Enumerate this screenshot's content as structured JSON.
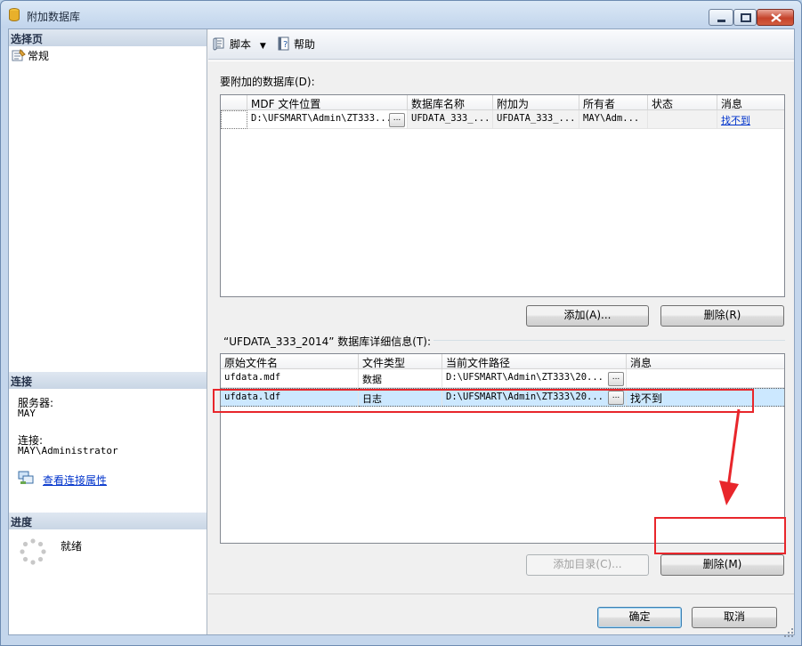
{
  "window": {
    "title": "附加数据库"
  },
  "left": {
    "select_page_header": "选择页",
    "pages": [
      {
        "label": "常规"
      }
    ],
    "connection_header": "连接",
    "server_label": "服务器:",
    "server_value": "MAY",
    "connection_label": "连接:",
    "connection_value": "MAY\\Administrator",
    "view_props_link": "查看连接属性",
    "progress_header": "进度",
    "progress_status": "就绪"
  },
  "toolbar": {
    "script_label": "脚本",
    "help_label": "帮助"
  },
  "attach": {
    "label": "要附加的数据库(D):",
    "columns": [
      "MDF 文件位置",
      "数据库名称",
      "附加为",
      "所有者",
      "状态",
      "消息"
    ],
    "rows": [
      {
        "mdf": "D:\\UFSMART\\Admin\\ZT333...",
        "db_name": "UFDATA_333_...",
        "attach_as": "UFDATA_333_...",
        "owner": "MAY\\Adm...",
        "status": "",
        "message": "找不到"
      }
    ],
    "add_button": "添加(A)...",
    "remove_button": "删除(R)"
  },
  "details": {
    "label": "“UFDATA_333_2014” 数据库详细信息(T):",
    "columns": [
      "原始文件名",
      "文件类型",
      "当前文件路径",
      "消息"
    ],
    "rows": [
      {
        "file": "ufdata.mdf",
        "type": "数据",
        "path": "D:\\UFSMART\\Admin\\ZT333\\20...",
        "message": ""
      },
      {
        "file": "ufdata.ldf",
        "type": "日志",
        "path": "D:\\UFSMART\\Admin\\ZT333\\20...",
        "message": "找不到"
      }
    ],
    "add_catalog_button": "添加目录(C)...",
    "remove_button": "删除(M)"
  },
  "footer": {
    "ok_button": "确定",
    "cancel_button": "取消"
  },
  "colors": {
    "annotation_red": "#e8262b",
    "selected_row": "#cce8ff"
  }
}
